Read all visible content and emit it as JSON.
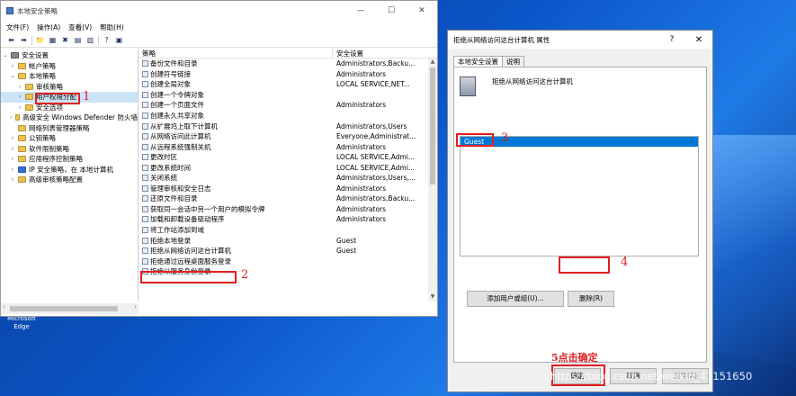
{
  "mmc": {
    "title": "本地安全策略",
    "menu": [
      "文件(F)",
      "操作(A)",
      "查看(V)",
      "帮助(H)"
    ],
    "win_buttons": [
      "—",
      "☐",
      "✕"
    ],
    "toolbar": [
      "⬅",
      "➡",
      "📁",
      "▦",
      "✖",
      "▤",
      "▥",
      "?",
      "▣"
    ],
    "tree": [
      {
        "label": "安全设置",
        "depth": 0,
        "exp": "⌄",
        "icon": "sec"
      },
      {
        "label": "帐户策略",
        "depth": 1,
        "exp": "›",
        "icon": "folder"
      },
      {
        "label": "本地策略",
        "depth": 1,
        "exp": "⌄",
        "icon": "folder"
      },
      {
        "label": "审核策略",
        "depth": 2,
        "exp": "›",
        "icon": "folder"
      },
      {
        "label": "用户权限分配",
        "depth": 2,
        "exp": "›",
        "icon": "folder",
        "selected": true
      },
      {
        "label": "安全选项",
        "depth": 2,
        "exp": "›",
        "icon": "folder"
      },
      {
        "label": "高级安全 Windows Defender 防火墙",
        "depth": 1,
        "exp": "›",
        "icon": "folder"
      },
      {
        "label": "网络列表管理器策略",
        "depth": 1,
        "exp": "",
        "icon": "folder"
      },
      {
        "label": "公钥策略",
        "depth": 1,
        "exp": "›",
        "icon": "folder"
      },
      {
        "label": "软件限制策略",
        "depth": 1,
        "exp": "›",
        "icon": "folder"
      },
      {
        "label": "应用程序控制策略",
        "depth": 1,
        "exp": "›",
        "icon": "folder"
      },
      {
        "label": "IP 安全策略，在 本地计算机",
        "depth": 1,
        "exp": "›",
        "icon": "blue"
      },
      {
        "label": "高级审核策略配置",
        "depth": 1,
        "exp": "›",
        "icon": "folder"
      }
    ],
    "columns": {
      "policy": "策略",
      "setting": "安全设置"
    },
    "rows": [
      {
        "policy": "备份文件和目录",
        "setting": "Administrators,Backu..."
      },
      {
        "policy": "创建符号链接",
        "setting": "Administrators"
      },
      {
        "policy": "创建全局对象",
        "setting": "LOCAL SERVICE,NET..."
      },
      {
        "policy": "创建一个令牌对象",
        "setting": ""
      },
      {
        "policy": "创建一个页面文件",
        "setting": "Administrators"
      },
      {
        "policy": "创建永久共享对象",
        "setting": ""
      },
      {
        "policy": "从扩展坞上取下计算机",
        "setting": "Administrators,Users"
      },
      {
        "policy": "从网络访问此计算机",
        "setting": "Everyone,Administrat..."
      },
      {
        "policy": "从远程系统强制关机",
        "setting": "Administrators"
      },
      {
        "policy": "更改时区",
        "setting": "LOCAL SERVICE,Admi..."
      },
      {
        "policy": "更改系统时间",
        "setting": "LOCAL SERVICE,Admi..."
      },
      {
        "policy": "关闭系统",
        "setting": "Administrators,Users,..."
      },
      {
        "policy": "管理审核和安全日志",
        "setting": "Administrators"
      },
      {
        "policy": "还原文件和目录",
        "setting": "Administrators,Backu..."
      },
      {
        "policy": "获取同一会话中另一个用户的模拟令牌",
        "setting": "Administrators"
      },
      {
        "policy": "加载和卸载设备驱动程序",
        "setting": "Administrators"
      },
      {
        "policy": "将工作站添加到域",
        "setting": ""
      },
      {
        "policy": "拒绝本地登录",
        "setting": "Guest"
      },
      {
        "policy": "拒绝从网络访问这台计算机",
        "setting": "Guest"
      },
      {
        "policy": "拒绝通过远程桌面服务登录",
        "setting": ""
      },
      {
        "policy": "拒绝以服务身份登录",
        "setting": ""
      }
    ]
  },
  "dialog": {
    "title": "拒绝从网络访问这台计算机 属性",
    "help": "?",
    "close": "✕",
    "tabs": [
      "本地安全设置",
      "说明"
    ],
    "heading": "拒绝从网络访问这台计算机",
    "users": [
      "Guest"
    ],
    "add_button": "添加用户或组(U)...",
    "remove_button": "删除(R)",
    "ok_button": "确定",
    "cancel_button": "取消",
    "apply_button": "应用(A)"
  },
  "annotations": {
    "n1": "1",
    "n2": "2",
    "n3": "3",
    "n4": "4",
    "note": "5点击确定"
  },
  "desktop": {
    "edge_label": "Microsoft Edge",
    "watermark": "https://blog.csdn.net/weixin_47151650"
  },
  "colors": {
    "selection": "#0078d7",
    "annotation": "#e02020"
  }
}
